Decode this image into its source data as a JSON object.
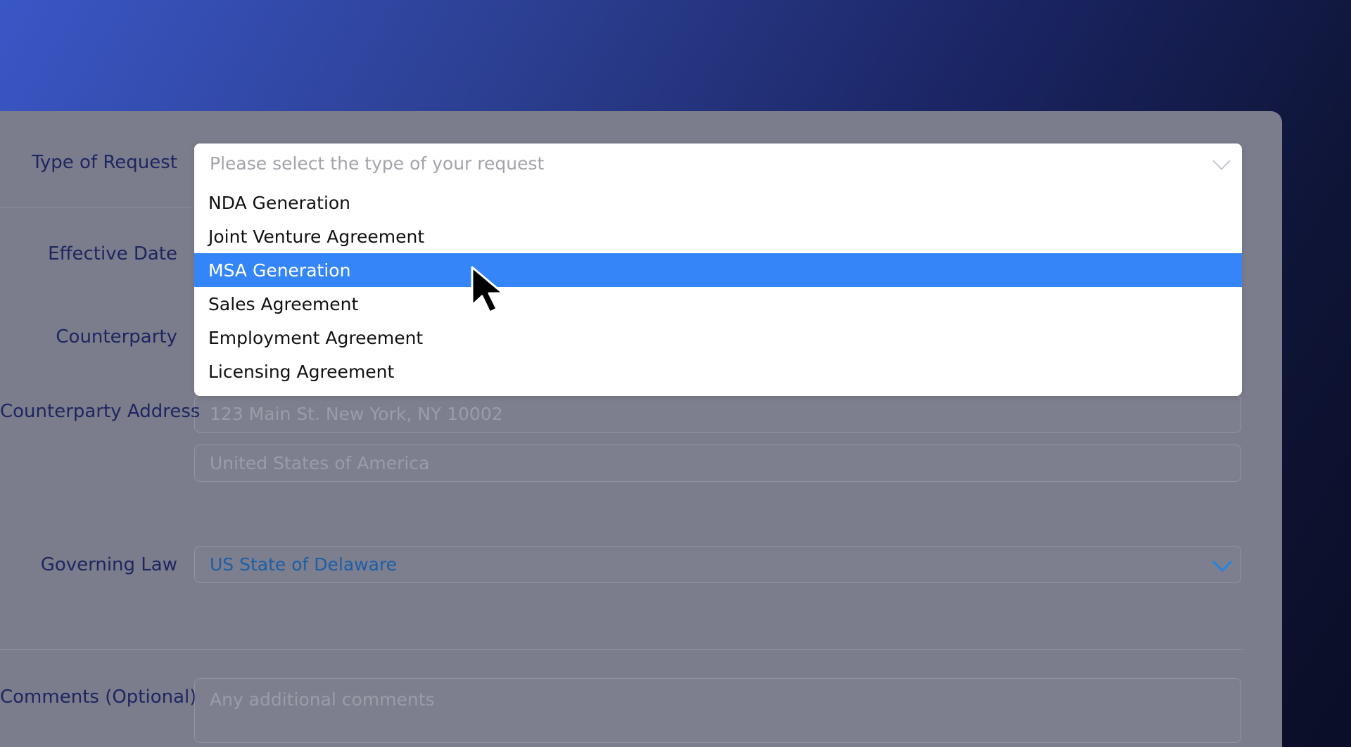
{
  "form": {
    "type_of_request": {
      "label": "Type of Request",
      "placeholder": "Please select the type of your request",
      "options": [
        "NDA Generation",
        "Joint Venture Agreement",
        "MSA Generation",
        "Sales Agreement",
        "Employment Agreement",
        "Licensing Agreement"
      ],
      "highlighted_option": "MSA Generation"
    },
    "effective_date": {
      "label": "Effective Date"
    },
    "counterparty": {
      "label": "Counterparty"
    },
    "counterparty_address": {
      "label": "Counterparty Address",
      "street_placeholder": "123 Main St. New York, NY 10002",
      "country_placeholder": "United States of America"
    },
    "governing_law": {
      "label": "Governing Law",
      "value": "US State of Delaware"
    },
    "comments": {
      "label": "Comments (Optional)",
      "placeholder": "Any additional comments"
    }
  },
  "colors": {
    "highlight": "#3485f7",
    "label": "#1e2660",
    "select_value": "#1b5fa8",
    "card_overlay": "#7b7d8c"
  },
  "icons": {
    "dropdown": "chevron-down-icon",
    "cursor": "mouse-pointer-icon"
  }
}
